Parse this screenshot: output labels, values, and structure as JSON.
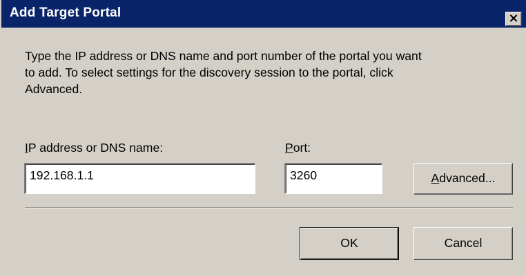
{
  "window": {
    "title": "Add Target Portal",
    "close_glyph": "×",
    "icons": {
      "close": "close-icon"
    }
  },
  "instructions": {
    "line1": "Type the IP address or DNS name and port number of the portal you want",
    "line2": "to add. To select settings for the discovery session to the portal, click",
    "line3": "Advanced."
  },
  "ip_field": {
    "label_mnemonic": "I",
    "label_rest": "P address or DNS name:",
    "value": "192.168.1.1"
  },
  "port_field": {
    "label_mnemonic": "P",
    "label_rest": "ort:",
    "value": "3260"
  },
  "buttons": {
    "advanced_mnemonic": "A",
    "advanced_rest": "dvanced...",
    "ok": "OK",
    "cancel": "Cancel"
  },
  "colors": {
    "titlebar": "#0a246a",
    "dialog_background": "#d4d0c8"
  }
}
